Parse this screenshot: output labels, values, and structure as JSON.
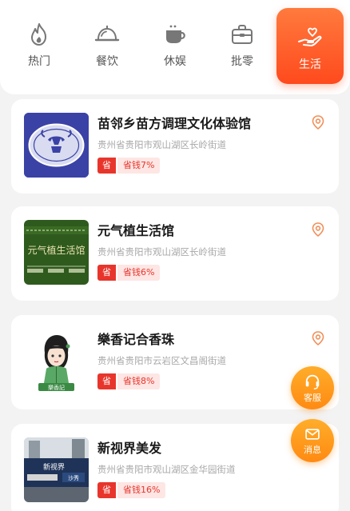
{
  "tabs": [
    {
      "label": "热门",
      "icon": "fire-icon"
    },
    {
      "label": "餐饮",
      "icon": "cloche-icon"
    },
    {
      "label": "休娱",
      "icon": "coffee-cup-icon"
    },
    {
      "label": "批零",
      "icon": "briefcase-icon"
    },
    {
      "label": "生活",
      "icon": "hand-heart-icon",
      "active": true
    }
  ],
  "shops": [
    {
      "name": "苗邻乡苗方调理文化体验馆",
      "address": "贵州省贵阳市观山湖区长岭街道",
      "tag": "省",
      "saving": "省钱7%"
    },
    {
      "name": "元气植生活馆",
      "address": "贵州省贵阳市观山湖区长岭街道",
      "tag": "省",
      "saving": "省钱6%"
    },
    {
      "name": "樂香记合香珠",
      "address": "贵州省贵阳市云岩区文昌阁街道",
      "tag": "省",
      "saving": "省钱8%"
    },
    {
      "name": "新视界美发",
      "address": "贵州省贵阳市观山湖区金华园街道",
      "tag": "省",
      "saving": "省钱16%"
    }
  ],
  "fab": {
    "service_label": "客服",
    "message_label": "消息"
  },
  "colors": {
    "accent": "#ff5a26",
    "badge": "#e8352b",
    "fab": "#ff9a1a"
  }
}
